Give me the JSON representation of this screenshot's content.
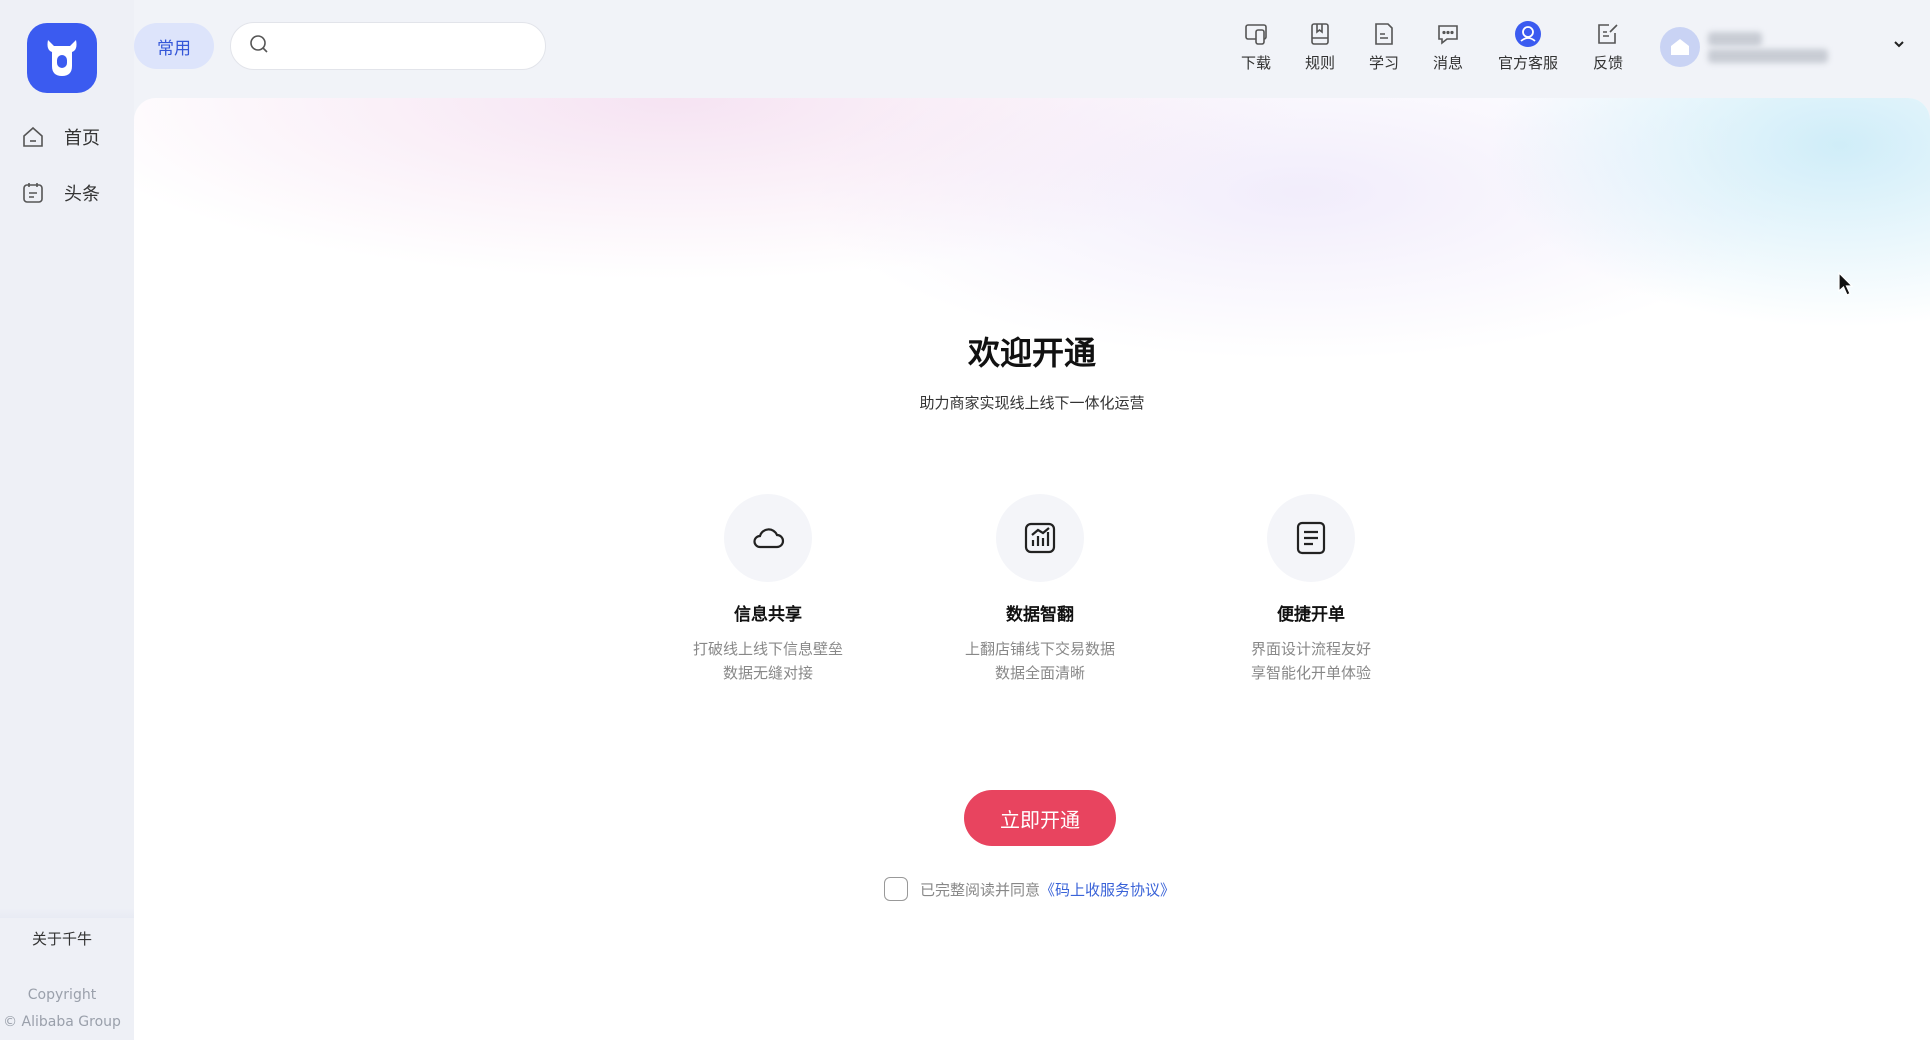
{
  "sidebar": {
    "items": [
      {
        "label": "首页",
        "icon": "home-icon"
      },
      {
        "label": "头条",
        "icon": "news-icon"
      }
    ],
    "about": "关于千牛",
    "copyright_line1": "Copyright",
    "copyright_line2": "© Alibaba Group"
  },
  "header": {
    "common_label": "常用",
    "search_placeholder": "",
    "tools": [
      {
        "label": "下载",
        "icon": "download-device-icon"
      },
      {
        "label": "规则",
        "icon": "rules-book-icon"
      },
      {
        "label": "学习",
        "icon": "learn-doc-icon"
      },
      {
        "label": "消息",
        "icon": "message-bubble-icon"
      },
      {
        "label": "官方客服",
        "icon": "customer-service-icon"
      },
      {
        "label": "反馈",
        "icon": "feedback-edit-icon"
      }
    ]
  },
  "main": {
    "title": "欢迎开通",
    "subtitle": "助力商家实现线上线下一体化运营",
    "features": [
      {
        "title": "信息共享",
        "desc_line1": "打破线上线下信息壁垒",
        "desc_line2": "数据无缝对接",
        "icon": "cloud-icon"
      },
      {
        "title": "数据智翻",
        "desc_line1": "上翻店铺线下交易数据",
        "desc_line2": "数据全面清晰",
        "icon": "chart-icon"
      },
      {
        "title": "便捷开单",
        "desc_line1": "界面设计流程友好",
        "desc_line2": "享智能化开单体验",
        "icon": "document-icon"
      }
    ],
    "cta_label": "立即开通",
    "agreement_prefix": "已完整阅读并同意",
    "agreement_link": "《码上收服务协议》"
  },
  "colors": {
    "brand": "#3b5bf0",
    "cta": "#e8445f",
    "link": "#3a63d8",
    "common_bg": "#dde4fb"
  }
}
